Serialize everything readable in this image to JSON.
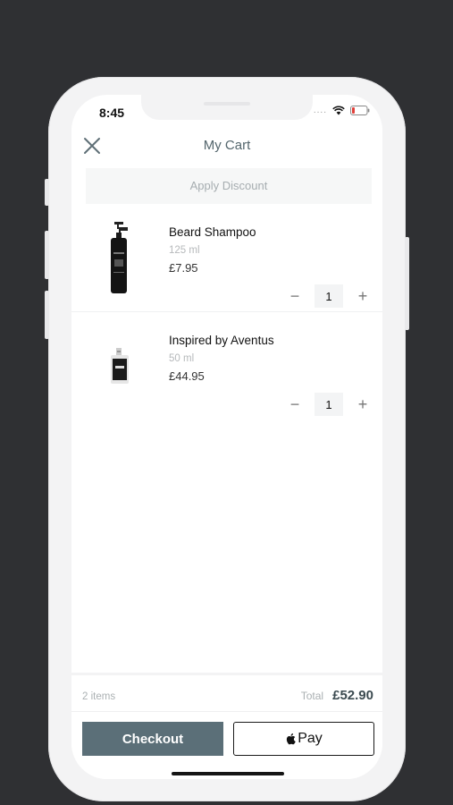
{
  "status_bar": {
    "time": "8:45",
    "signal": "....",
    "icons": [
      "wifi-icon",
      "battery-icon"
    ]
  },
  "header": {
    "title": "My Cart",
    "close_icon": "close-icon"
  },
  "discount": {
    "label": "Apply Discount"
  },
  "cart": {
    "items": [
      {
        "name": "Beard Shampoo",
        "size": "125 ml",
        "price": "£7.95",
        "quantity": "1"
      },
      {
        "name": "Inspired by  Aventus",
        "size": "50 ml",
        "price": "£44.95",
        "quantity": "1"
      }
    ],
    "qty_minus": "−",
    "qty_plus": "+"
  },
  "footer": {
    "items_count": "2 items",
    "total_label": "Total",
    "total_value": "£52.90",
    "checkout_label": "Checkout",
    "applepay_label": "Pay"
  },
  "colors": {
    "background": "#2f3033",
    "accent": "#5b6f78",
    "title": "#54666d",
    "muted": "#aab0b2"
  }
}
